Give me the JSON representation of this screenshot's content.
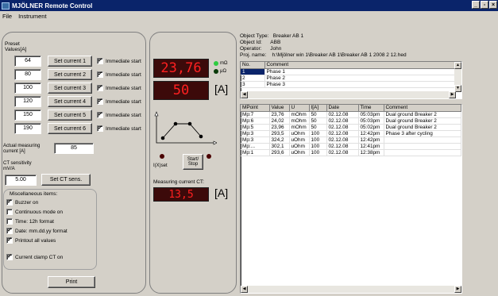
{
  "window": {
    "title": "MJÖLNER Remote Control"
  },
  "menu": [
    "File",
    "Instrument"
  ],
  "preset": {
    "label": "Preset\nValues[A]",
    "rows": [
      {
        "value": "64",
        "button": "Set current 1",
        "immediate": "Immediate start"
      },
      {
        "value": "80",
        "button": "Set current 2",
        "immediate": "Immediate start"
      },
      {
        "value": "100",
        "button": "Set current 3",
        "immediate": "Immediate start"
      },
      {
        "value": "120",
        "button": "Set current 4",
        "immediate": "Immediate start"
      },
      {
        "value": "150",
        "button": "Set current 5",
        "immediate": "Immediate start"
      },
      {
        "value": "190",
        "button": "Set current 6",
        "immediate": "Immediate start"
      }
    ]
  },
  "actual_current": {
    "label": "Actual measuring current [A]",
    "value": "85"
  },
  "ct": {
    "label": "CT sensitivity mV/A",
    "value": "5.00",
    "button": "Set CT sens."
  },
  "misc": {
    "title": "Miscellaneous items:",
    "items": [
      {
        "label": "Buzzer on",
        "checked": true
      },
      {
        "label": "Continuous mode on",
        "checked": false
      },
      {
        "label": "Time: 12h format",
        "checked": false
      },
      {
        "label": "Date: mm.dd.yy format",
        "checked": true
      },
      {
        "label": "Printout all values",
        "checked": true
      }
    ],
    "clamp": {
      "label": "Current clamp CT on",
      "checked": true
    }
  },
  "print_button": "Print",
  "display": {
    "resistance": "23,76",
    "unit_mohm": "mΩ",
    "unit_uohm": "μΩ",
    "current": "50",
    "current_unit": "[A]",
    "iset_label": "I(X)set",
    "start_stop": "Start/\nStop",
    "ct_label": "Measuring current CT:",
    "ct_value": "13,5",
    "ct_unit": "[A]"
  },
  "object_info": {
    "type": "Object Type:   Breaker AB 1",
    "id": "Object Id:      ABB",
    "operator": "Operator:      John",
    "proj": "Proj. name:    h:\\Mjölner win 1\\Breaker AB 1\\Breaker AB 1 2008 2 12.hed"
  },
  "phases": {
    "headers": [
      "No.",
      "Comment"
    ],
    "rows": [
      [
        "1",
        "Phase 1"
      ],
      [
        "2",
        "Phase 2"
      ],
      [
        "3",
        "Phase 3"
      ]
    ]
  },
  "measurements": {
    "headers": [
      "MPoint",
      "Value",
      "U",
      "I[A]",
      "Date",
      "Time",
      "Comment"
    ],
    "rows": [
      [
        "Mp:7",
        "23,76",
        "mOhm",
        "50",
        "02.12.08",
        "05:03pm",
        "Dual ground Breaker 2"
      ],
      [
        "Mp:6",
        "24,02",
        "mOhm",
        "50",
        "02.12.08",
        "05:03pm",
        "Dual ground Breaker 2"
      ],
      [
        "Mp:5",
        "23,96",
        "mOhm",
        "50",
        "02.12.08",
        "05:02pm",
        "Dual ground Breaker 2"
      ],
      [
        "Mp:3",
        "293,5",
        "uOhm",
        "100",
        "02.12.08",
        "12:42pm",
        "Phase 3 after cycling"
      ],
      [
        "Mp:3",
        "324,2",
        "uOhm",
        "100",
        "02.12.08",
        "12:42pm",
        ""
      ],
      [
        "Mp:...",
        "302,1",
        "uOhm",
        "100",
        "02.12.08",
        "12:41pm",
        ""
      ],
      [
        "Mp:1",
        "293,6",
        "uOhm",
        "100",
        "02.12.08",
        "12:38pm",
        ""
      ]
    ]
  }
}
